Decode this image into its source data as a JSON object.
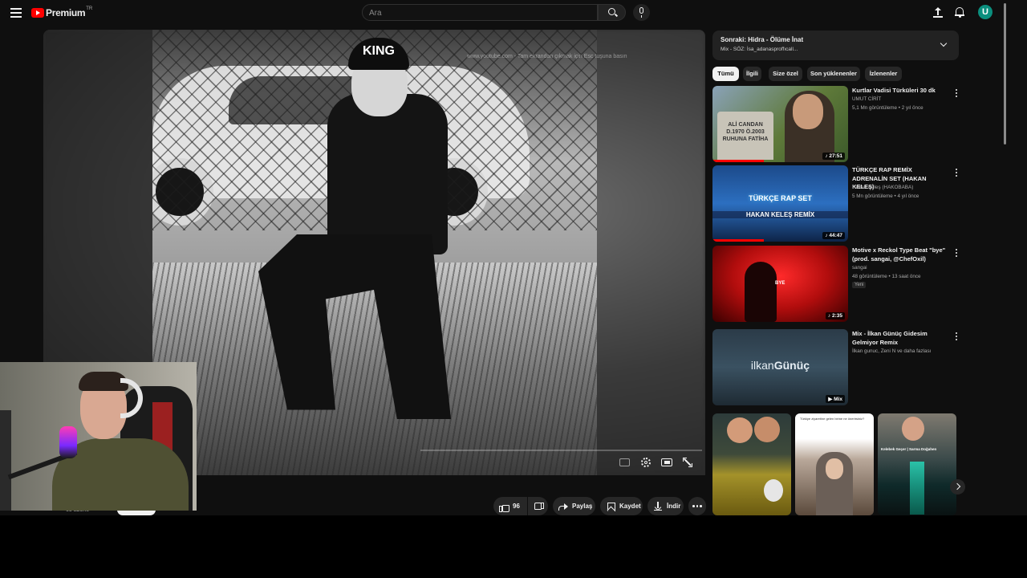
{
  "header": {
    "logo_text": "Premium",
    "country_code": "TR",
    "search_placeholder": "Ara",
    "avatar_initial": "U"
  },
  "player": {
    "cap_text": "KING",
    "watermark": "www.youtube.com - Tam ekrandan çıkmak için  Esc  tuşuna basın"
  },
  "channel": {
    "subscribers": "65 abone"
  },
  "actions": {
    "like_count": "96",
    "share_label": "Paylaş",
    "save_label": "Kaydet",
    "download_label": "İndir"
  },
  "up_next": {
    "title": "Sonraki: Hidra - Ölüme İnat",
    "subtitle": "Mix - SÖZ: İsa_adanasproffıcall..."
  },
  "chips": [
    "Tümü",
    "İlgili",
    "Size özel",
    "Son yüklenenler",
    "İzlenenler"
  ],
  "recommendations": [
    {
      "title": "Kurtlar Vadisi Türküleri 30 dk",
      "channel": "UMUT CİRİT",
      "meta": "5,1 Mn görüntüleme • 2 yıl önce",
      "duration": "27:51",
      "thumb_text": "ALİ CANDAN\nD.1970 Ö.2003\nRUHUNA FATİHA",
      "progress": 0.38
    },
    {
      "title": "TÜRKÇE RAP REMİX ADRENALİN SET (HAKAN KELEŞ)",
      "channel": "Hakan Keleş (HAKOBABA)",
      "meta": "5 Mn görüntüleme • 4 yıl önce",
      "duration": "44:47",
      "thumb_line1": "TÜRKÇE RAP SET",
      "thumb_line2": "HAKAN KELEŞ REMİX",
      "progress": 0.38
    },
    {
      "title": "Motive x Reckol Type Beat \"bye\" (prod. sangai, @ChefOxil)",
      "channel": "sangai",
      "meta": "48 görüntüleme • 13 saat önce",
      "badge": "Yeni",
      "duration": "2:35",
      "thumb_text": "BYE"
    },
    {
      "title": "Mix - İlkan Günüç Gidesim Gelmiyor Remix",
      "channel": "İlkan gunuc, Zeni N ve daha fazlası",
      "duration": "Mix",
      "thumb_name_a": "ilkan",
      "thumb_name_b": "Günüç"
    }
  ],
  "shorts": [
    {
      "caption": ""
    },
    {
      "caption": "Türkiye ziyaretine gelen birine ne önerirsiniz?"
    },
    {
      "caption": "Kelebek Geçer | Sarma Doğahen"
    }
  ]
}
